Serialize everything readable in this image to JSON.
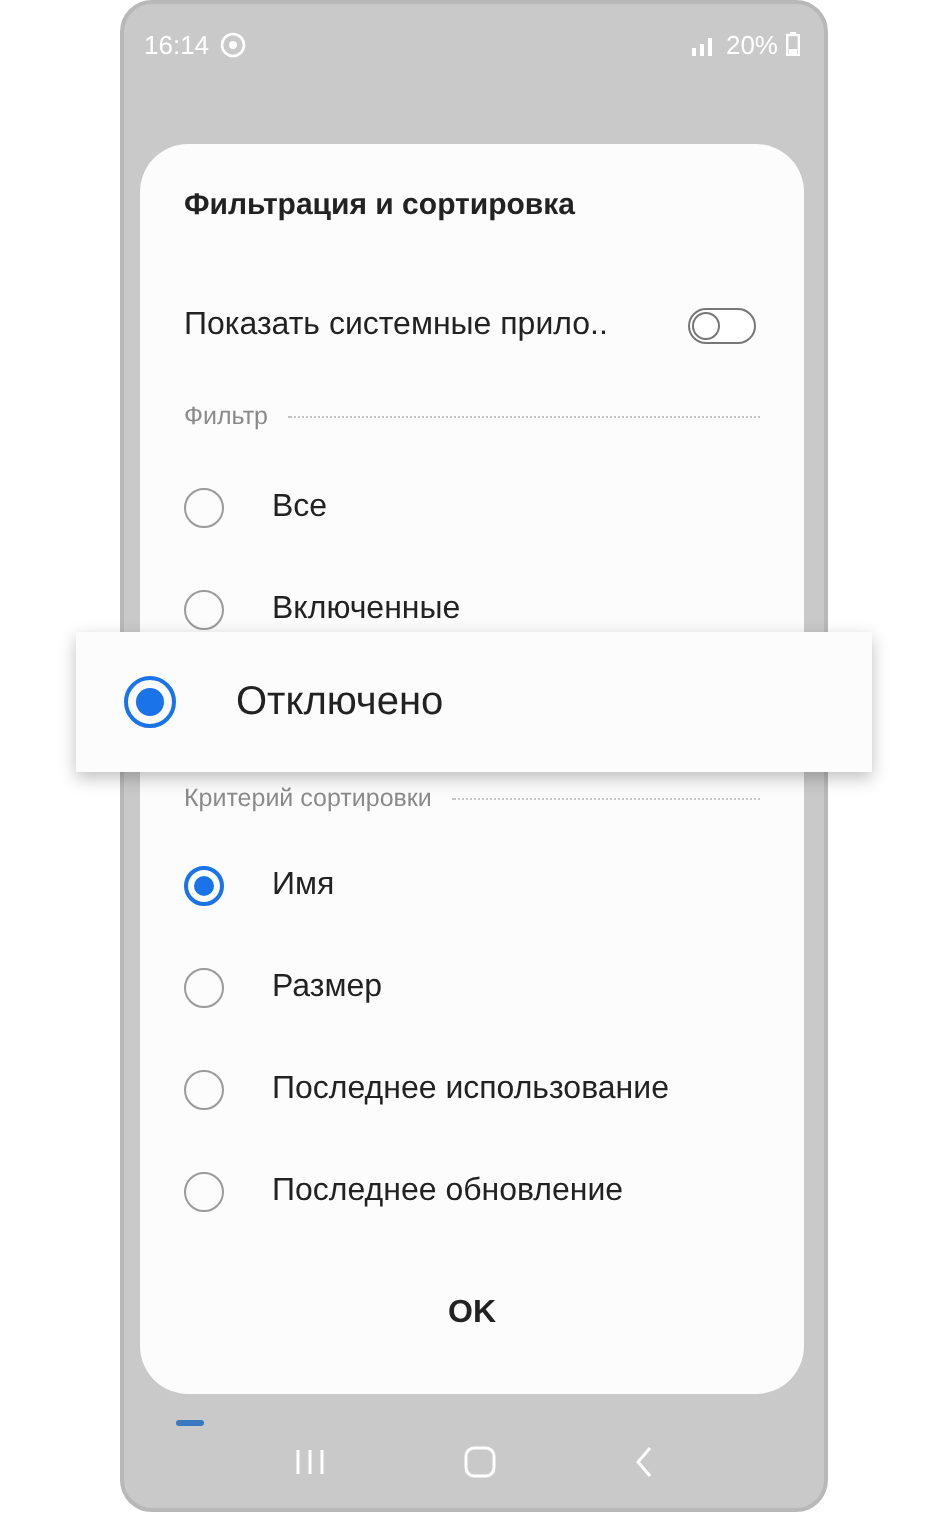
{
  "status_bar": {
    "time": "16:14",
    "battery": "20%"
  },
  "dialog": {
    "title": "Фильтрация и сортировка",
    "toggle": {
      "label": "Показать системные прило..",
      "on": false
    },
    "filter_header": "Фильтр",
    "filter_items": [
      {
        "label": "Все",
        "selected": false,
        "kind": "plain"
      },
      {
        "label": "Включенные",
        "selected": false,
        "kind": "plain"
      },
      {
        "label": "Отключено",
        "selected": true,
        "kind": "callout"
      }
    ],
    "sort_header": "Критерий сортировки",
    "sort_items": [
      {
        "label": "Имя",
        "selected": true,
        "kind": "plain"
      },
      {
        "label": "Размер",
        "selected": false,
        "kind": "plain"
      },
      {
        "label": "Последнее использование",
        "selected": false,
        "kind": "plain"
      },
      {
        "label": "Последнее обновление",
        "selected": false,
        "kind": "plain"
      }
    ],
    "ok_button": "OK"
  }
}
